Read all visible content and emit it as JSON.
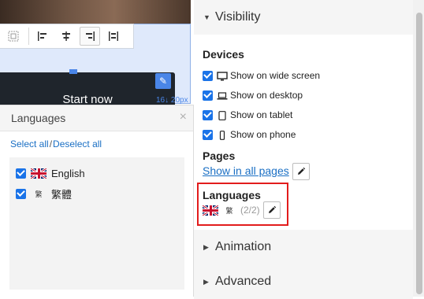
{
  "canvas": {
    "button_label": "Start now",
    "dimension_label": "16↓ 20px"
  },
  "languages_popup": {
    "title": "Languages",
    "close_glyph": "×",
    "select_all": "Select all",
    "deselect_all": "Deselect all",
    "items": [
      {
        "label": "English",
        "checked": true,
        "flag": "uk-flag"
      },
      {
        "label": "繁體",
        "checked": true,
        "flag_glyph": "繁"
      }
    ]
  },
  "panel": {
    "visibility": {
      "title": "Visibility",
      "expanded": true,
      "devices_title": "Devices",
      "devices": [
        {
          "label": "Show on wide screen",
          "icon": "monitor-icon",
          "checked": true
        },
        {
          "label": "Show on desktop",
          "icon": "laptop-icon",
          "checked": true
        },
        {
          "label": "Show on tablet",
          "icon": "tablet-icon",
          "checked": true
        },
        {
          "label": "Show on phone",
          "icon": "phone-icon",
          "checked": true
        }
      ],
      "pages_title": "Pages",
      "pages_link": "Show in all pages",
      "languages_title": "Languages",
      "languages_glyph": "繁",
      "languages_count": "(2/2)"
    },
    "animation": {
      "title": "Animation"
    },
    "advanced": {
      "title": "Advanced"
    }
  },
  "colors": {
    "accent": "#1a73e8",
    "link": "#1a6fc4",
    "highlight": "#e21c1c",
    "button_bg": "#1f252c"
  }
}
